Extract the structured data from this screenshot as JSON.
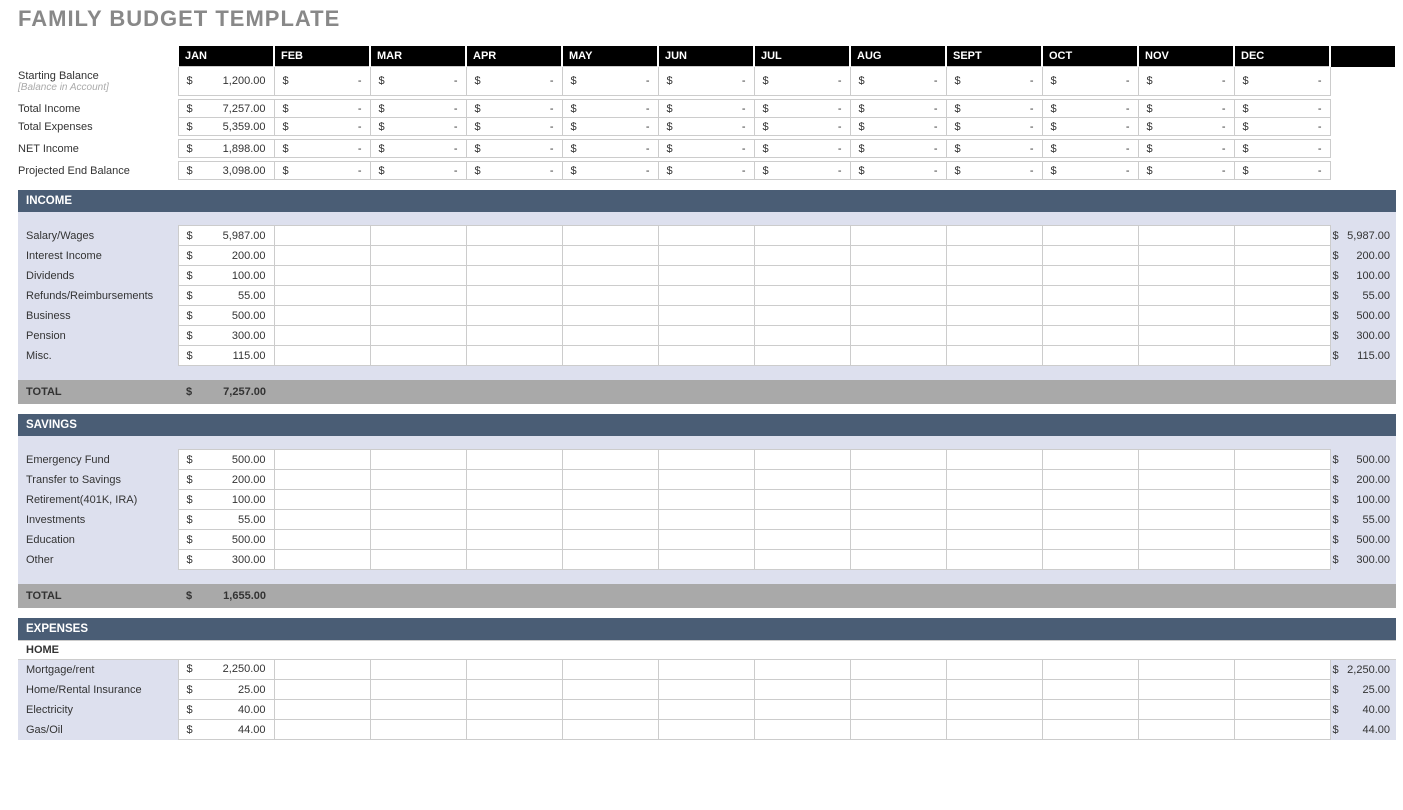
{
  "title": "FAMILY BUDGET TEMPLATE",
  "months": [
    "JAN",
    "FEB",
    "MAR",
    "APR",
    "MAY",
    "JUN",
    "JUL",
    "AUG",
    "SEPT",
    "OCT",
    "NOV",
    "DEC"
  ],
  "summary": {
    "starting_balance": {
      "label": "Starting Balance",
      "sublabel": "[Balance in Account]",
      "jan": "1,200.00"
    },
    "total_income": {
      "label": "Total Income",
      "jan": "7,257.00"
    },
    "total_expenses": {
      "label": "Total Expenses",
      "jan": "5,359.00"
    },
    "net_income": {
      "label": "NET Income",
      "jan": "1,898.00"
    },
    "projected_end": {
      "label": "Projected End Balance",
      "jan": "3,098.00"
    }
  },
  "sections": {
    "income": {
      "heading": "INCOME",
      "rows": [
        {
          "label": "Salary/Wages",
          "jan": "5,987.00",
          "total": "5,987.00"
        },
        {
          "label": "Interest Income",
          "jan": "200.00",
          "total": "200.00"
        },
        {
          "label": "Dividends",
          "jan": "100.00",
          "total": "100.00"
        },
        {
          "label": "Refunds/Reimbursements",
          "jan": "55.00",
          "total": "55.00"
        },
        {
          "label": "Business",
          "jan": "500.00",
          "total": "500.00"
        },
        {
          "label": "Pension",
          "jan": "300.00",
          "total": "300.00"
        },
        {
          "label": "Misc.",
          "jan": "115.00",
          "total": "115.00"
        }
      ],
      "total_label": "TOTAL",
      "total_jan": "7,257.00"
    },
    "savings": {
      "heading": "SAVINGS",
      "rows": [
        {
          "label": "Emergency Fund",
          "jan": "500.00",
          "total": "500.00"
        },
        {
          "label": "Transfer to Savings",
          "jan": "200.00",
          "total": "200.00"
        },
        {
          "label": "Retirement(401K, IRA)",
          "jan": "100.00",
          "total": "100.00"
        },
        {
          "label": "Investments",
          "jan": "55.00",
          "total": "55.00"
        },
        {
          "label": "Education",
          "jan": "500.00",
          "total": "500.00"
        },
        {
          "label": "Other",
          "jan": "300.00",
          "total": "300.00"
        }
      ],
      "total_label": "TOTAL",
      "total_jan": "1,655.00"
    },
    "expenses": {
      "heading": "EXPENSES",
      "subheading": "HOME",
      "rows": [
        {
          "label": "Mortgage/rent",
          "jan": "2,250.00",
          "total": "2,250.00"
        },
        {
          "label": "Home/Rental Insurance",
          "jan": "25.00",
          "total": "25.00"
        },
        {
          "label": "Electricity",
          "jan": "40.00",
          "total": "40.00"
        },
        {
          "label": "Gas/Oil",
          "jan": "44.00",
          "total": "44.00"
        }
      ]
    }
  },
  "dash": "-",
  "cur": "$"
}
